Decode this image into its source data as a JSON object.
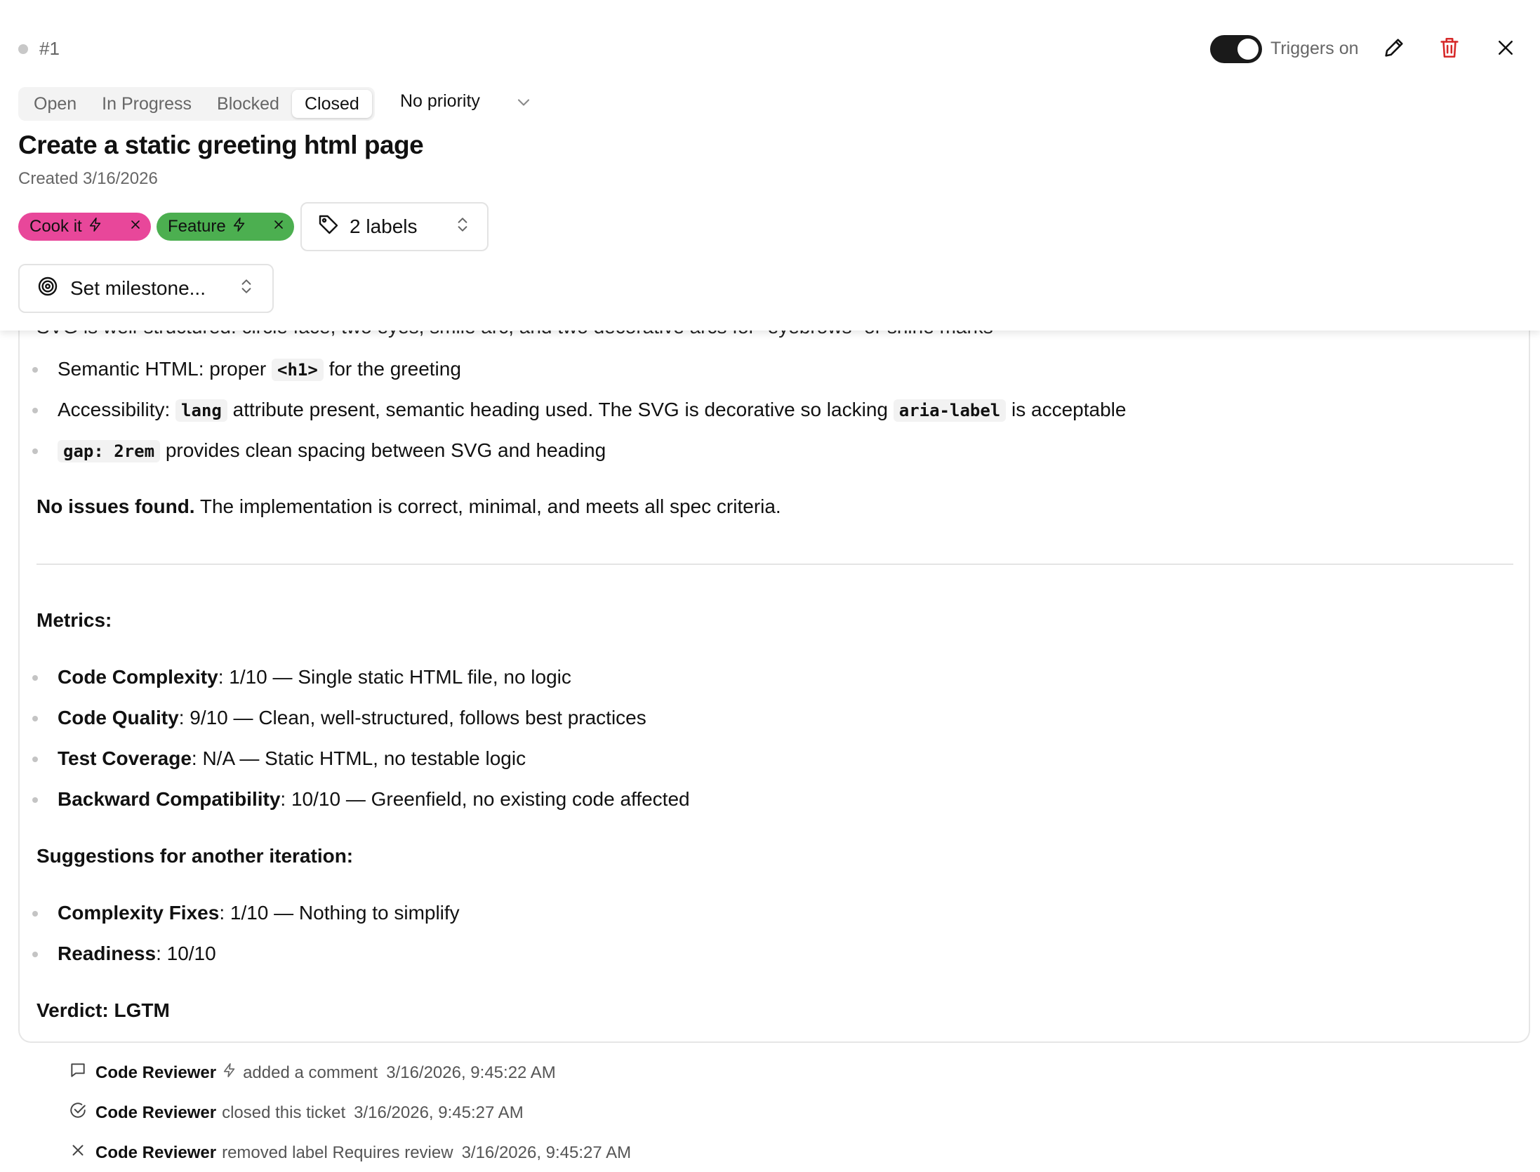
{
  "header": {
    "ticket_id": "#1",
    "triggers_label": "Triggers on",
    "status_tabs": [
      "Open",
      "In Progress",
      "Blocked",
      "Closed"
    ],
    "active_status": "Closed",
    "priority": "No priority",
    "title": "Create a static greeting html page",
    "created": "Created 3/16/2026",
    "labels": [
      {
        "text": "Cook it",
        "color": "#e8479a"
      },
      {
        "text": "Feature",
        "color": "#4caf50"
      }
    ],
    "labels_button": "2 labels",
    "milestone_button": "Set milestone..."
  },
  "review": {
    "partial_line": "SVG is well-structured: circle face, two eyes, smile arc, and two decorative arcs for \"eyebrows\" or shine marks",
    "points": [
      {
        "pre": "Semantic HTML: proper ",
        "code": "<h1>",
        "post": " for the greeting"
      },
      {
        "pre": "Accessibility: ",
        "code": "lang",
        "mid": " attribute present, semantic heading used. The SVG is decorative so lacking ",
        "code2": "aria-label",
        "post": " is acceptable"
      },
      {
        "code": "gap: 2rem",
        "post": " provides clean spacing between SVG and heading"
      }
    ],
    "conclusion_bold": "No issues found.",
    "conclusion_rest": " The implementation is correct, minimal, and meets all spec criteria.",
    "metrics_title": "Metrics:",
    "metrics": [
      {
        "name": "Code Complexity",
        "value": ": 1/10 — Single static HTML file, no logic"
      },
      {
        "name": "Code Quality",
        "value": ": 9/10 — Clean, well-structured, follows best practices"
      },
      {
        "name": "Test Coverage",
        "value": ": N/A — Static HTML, no testable logic"
      },
      {
        "name": "Backward Compatibility",
        "value": ": 10/10 — Greenfield, no existing code affected"
      }
    ],
    "suggestions_title": "Suggestions for another iteration:",
    "suggestions": [
      {
        "name": "Complexity Fixes",
        "value": ": 1/10 — Nothing to simplify"
      },
      {
        "name": "Readiness",
        "value": ": 10/10"
      }
    ],
    "verdict": "Verdict: LGTM"
  },
  "activity": [
    {
      "icon": "comment-icon",
      "who": "Code Reviewer",
      "what": "added a comment",
      "when": "3/16/2026, 9:45:22 AM"
    },
    {
      "icon": "check-circle-icon",
      "who": "Code Reviewer",
      "what": "closed this ticket",
      "when": "3/16/2026, 9:45:27 AM"
    },
    {
      "icon": "x-icon",
      "who": "Code Reviewer",
      "what": "removed label Requires review",
      "when": "3/16/2026, 9:45:27 AM"
    }
  ],
  "colors": {
    "toggle_on": "#1a1a1a",
    "delete": "#d62828",
    "muted": "#666666"
  }
}
